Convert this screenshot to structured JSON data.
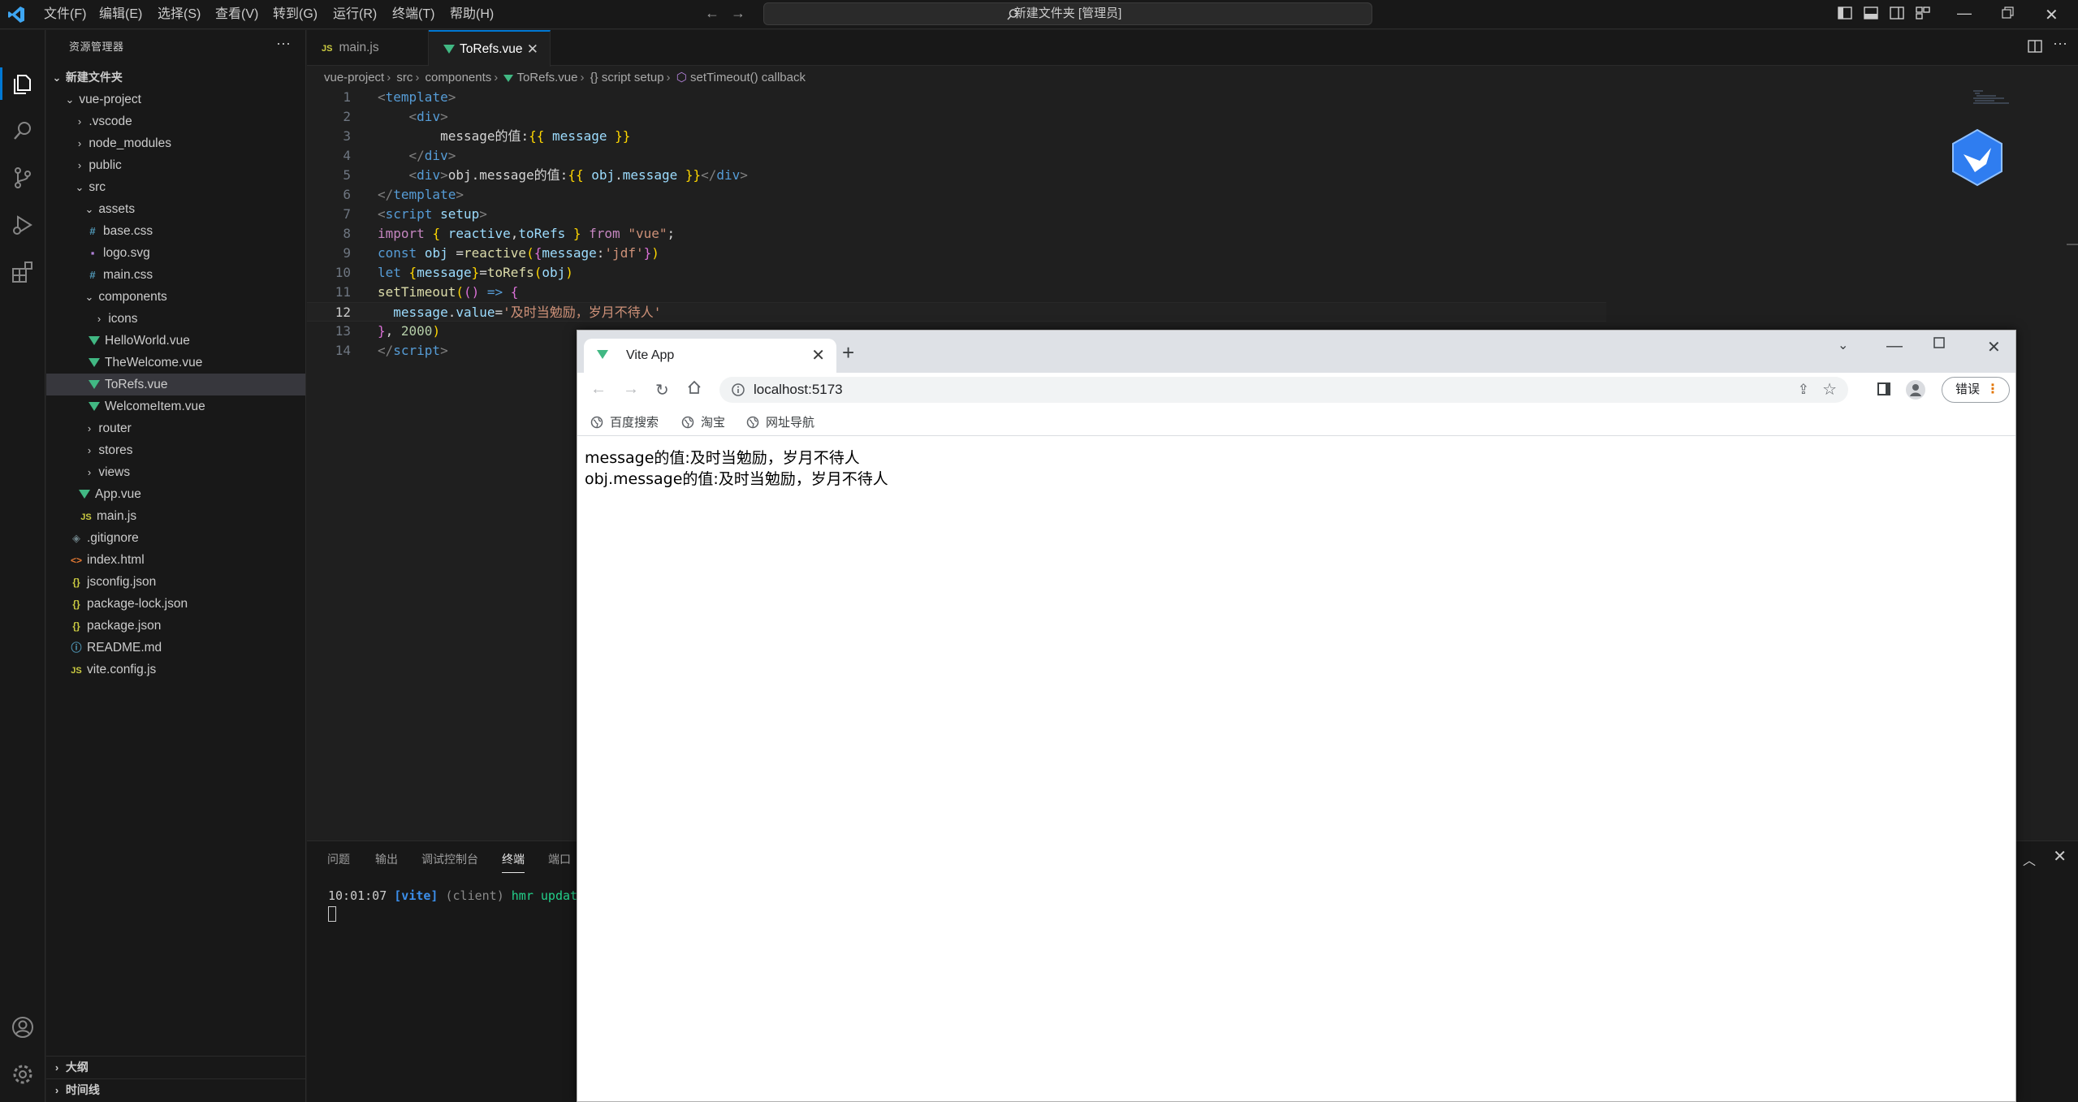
{
  "titlebar": {
    "menus": [
      "文件(F)",
      "编辑(E)",
      "选择(S)",
      "查看(V)",
      "转到(G)",
      "运行(R)",
      "终端(T)",
      "帮助(H)"
    ],
    "command_center": "新建文件夹 [管理员]"
  },
  "sidebar": {
    "title": "资源管理器",
    "more": "···",
    "root": "新建文件夹",
    "items": [
      {
        "label": "vue-project",
        "type": "folder-open"
      },
      {
        "label": ".vscode",
        "type": "folder"
      },
      {
        "label": "node_modules",
        "type": "folder"
      },
      {
        "label": "public",
        "type": "folder"
      },
      {
        "label": "src",
        "type": "folder-open"
      },
      {
        "label": "assets",
        "type": "folder-open"
      },
      {
        "label": "base.css",
        "type": "css"
      },
      {
        "label": "logo.svg",
        "type": "svg"
      },
      {
        "label": "main.css",
        "type": "css"
      },
      {
        "label": "components",
        "type": "folder-open"
      },
      {
        "label": "icons",
        "type": "folder"
      },
      {
        "label": "HelloWorld.vue",
        "type": "vue"
      },
      {
        "label": "TheWelcome.vue",
        "type": "vue"
      },
      {
        "label": "ToRefs.vue",
        "type": "vue",
        "selected": true
      },
      {
        "label": "WelcomeItem.vue",
        "type": "vue"
      },
      {
        "label": "router",
        "type": "folder"
      },
      {
        "label": "stores",
        "type": "folder"
      },
      {
        "label": "views",
        "type": "folder"
      },
      {
        "label": "App.vue",
        "type": "vue"
      },
      {
        "label": "main.js",
        "type": "js"
      },
      {
        "label": ".gitignore",
        "type": "git"
      },
      {
        "label": "index.html",
        "type": "html"
      },
      {
        "label": "jsconfig.json",
        "type": "json"
      },
      {
        "label": "package-lock.json",
        "type": "json"
      },
      {
        "label": "package.json",
        "type": "json"
      },
      {
        "label": "README.md",
        "type": "info"
      },
      {
        "label": "vite.config.js",
        "type": "js"
      }
    ],
    "outline": "大纲",
    "timeline": "时间线"
  },
  "tabs": {
    "main": "main.js",
    "torefs": "ToRefs.vue",
    "js_badge": "JS",
    "close": "✕"
  },
  "breadcrumbs": [
    "vue-project",
    "src",
    "components",
    "ToRefs.vue",
    "{} script setup",
    "setTimeout() callback"
  ],
  "code": {
    "line_numbers": [
      "1",
      "2",
      "3",
      "4",
      "5",
      "6",
      "7",
      "8",
      "9",
      "10",
      "11",
      "12",
      "13",
      "14"
    ],
    "current_line": 12
  },
  "panel": {
    "tabs": [
      "问题",
      "输出",
      "调试控制台",
      "终端",
      "端口"
    ],
    "terminal": {
      "time": "10:01:07",
      "vite": "[vite]",
      "client": "(client)",
      "msg": "hmr updat"
    }
  },
  "browser": {
    "tab_title": "Vite App",
    "new_tab": "+",
    "url": "localhost:5173",
    "error_button": "错误",
    "bookmarks": [
      "百度搜索",
      "淘宝",
      "网址导航"
    ],
    "content": [
      "message的值:及时当勉励，岁月不待人",
      "obj.message的值:及时当勉励，岁月不待人"
    ]
  },
  "colors": {
    "accent": "#0078d4",
    "vue": "#41b883",
    "editor_bg": "#1f1f1f",
    "sidebar_bg": "#181818"
  }
}
